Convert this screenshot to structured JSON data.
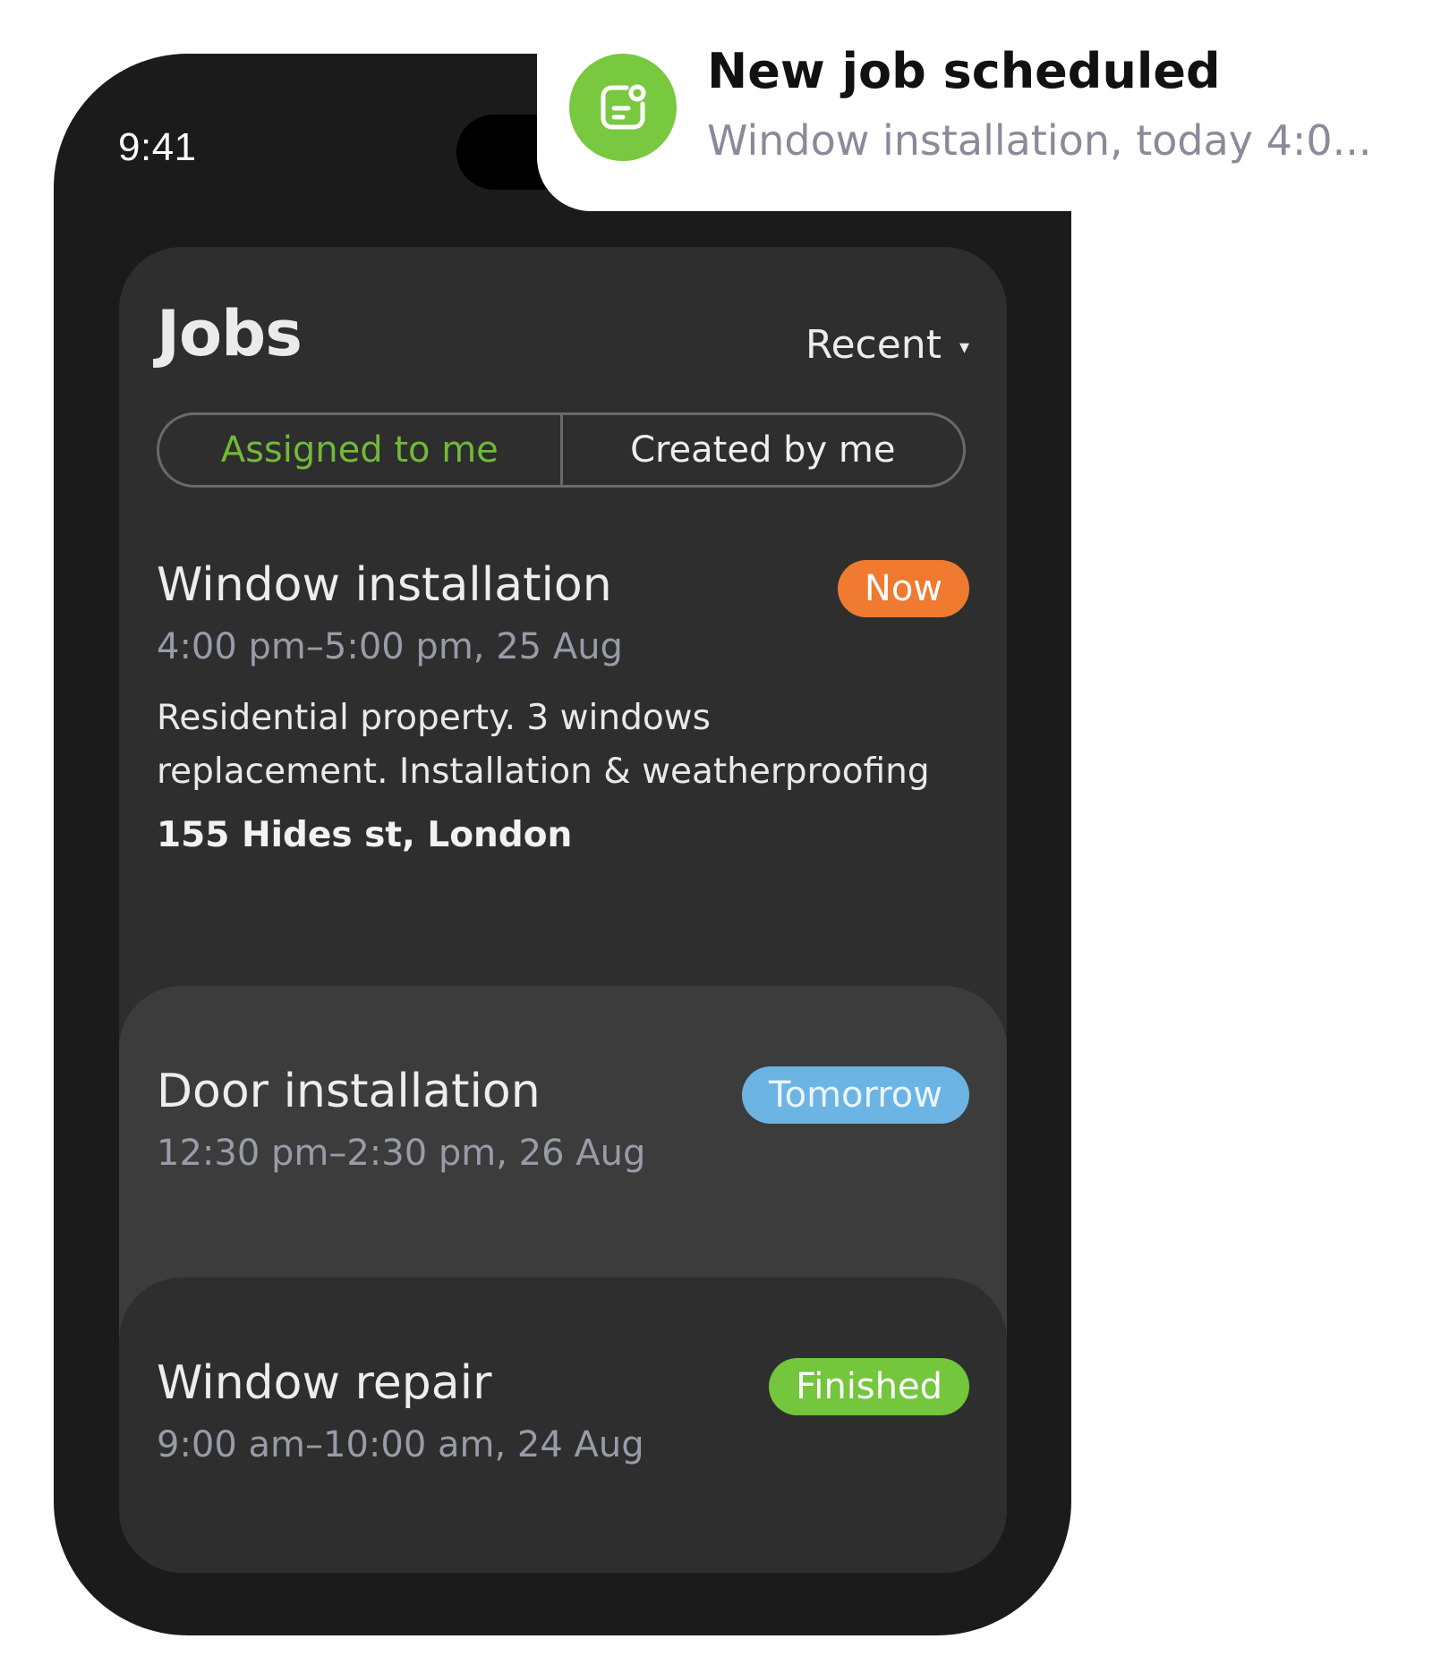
{
  "status_bar": {
    "time": "9:41"
  },
  "notification": {
    "icon": "note-icon",
    "icon_color": "#78c840",
    "title": "New job scheduled",
    "body": "Window installation, today 4:0..."
  },
  "jobs_screen": {
    "title": "Jobs",
    "sort_label": "Recent",
    "sort_caret": "▾",
    "tabs": [
      {
        "label": "Assigned to me",
        "active": true
      },
      {
        "label": "Created by me",
        "active": false
      }
    ],
    "jobs": [
      {
        "title": "Window installation",
        "time": "4:00 pm–5:00 pm, 25 Aug",
        "badge": "Now",
        "badge_color": "#ef7a30",
        "description": "Residential property. 3 windows replacement. Installation & weatherproofing",
        "address": "155 Hides st, London"
      },
      {
        "title": "Door installation",
        "time": "12:30 pm–2:30 pm, 26 Aug",
        "badge": "Tomorrow",
        "badge_color": "#6cb4e4"
      },
      {
        "title": "Window repair",
        "time": "9:00 am–10:00 am, 24 Aug",
        "badge": "Finished",
        "badge_color": "#74c63d"
      }
    ]
  }
}
